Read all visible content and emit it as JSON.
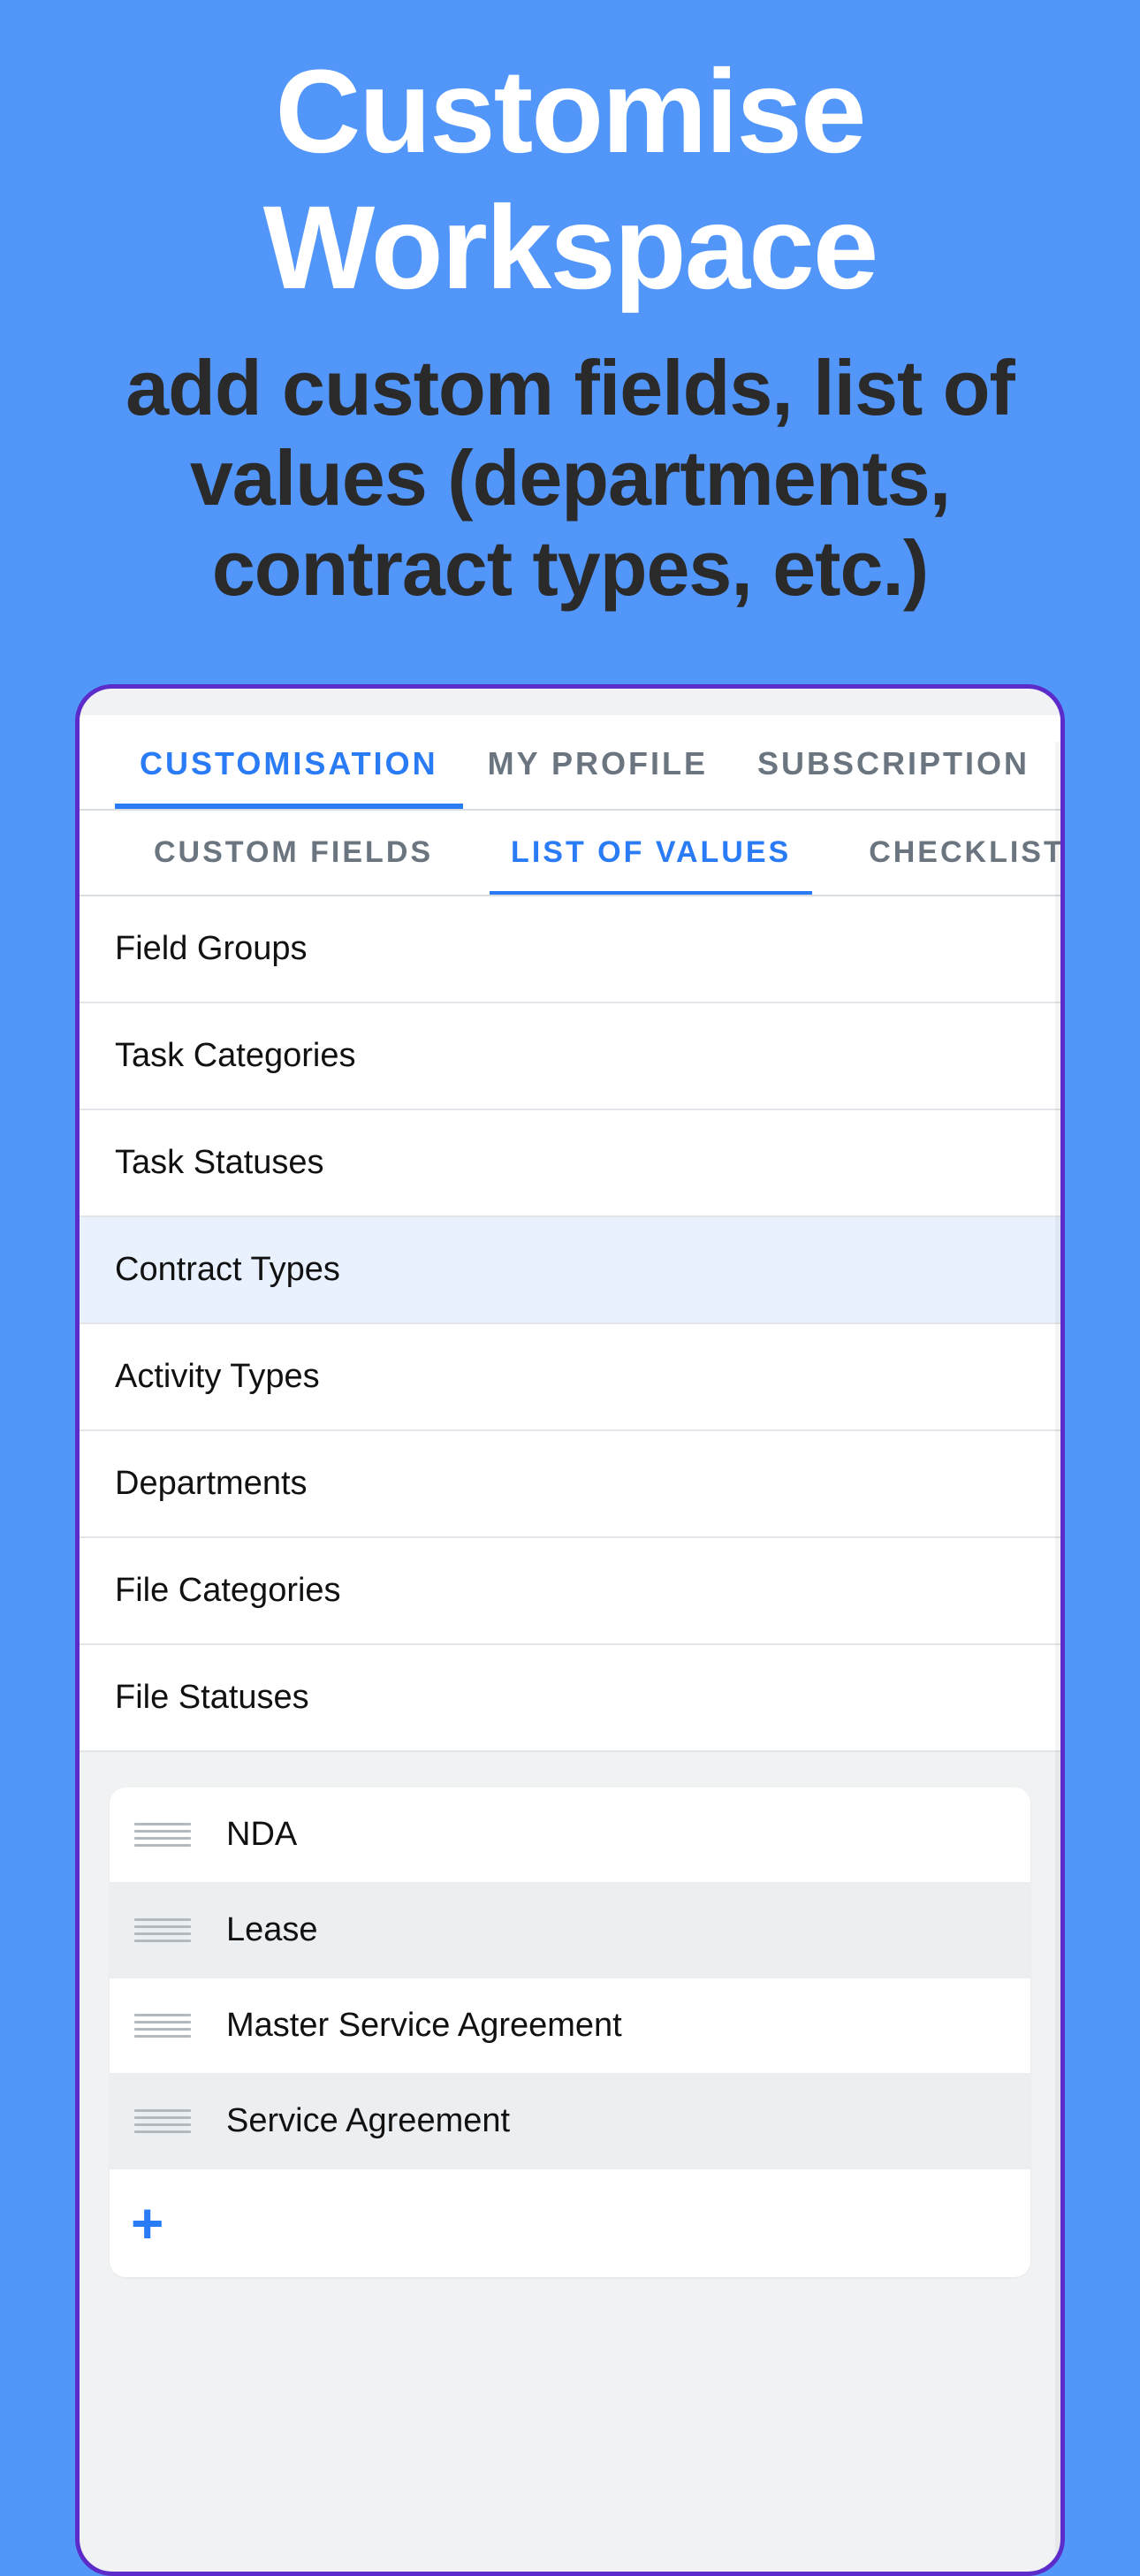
{
  "hero": {
    "title": "Customise Workspace",
    "subtitle": "add custom fields, list of values (departments, contract types, etc.)"
  },
  "tabs_primary": [
    {
      "label": "CUSTOMISATION",
      "active": true
    },
    {
      "label": "MY PROFILE",
      "active": false
    },
    {
      "label": "SUBSCRIPTION",
      "active": false
    }
  ],
  "tabs_secondary": [
    {
      "label": "CUSTOM FIELDS",
      "active": false
    },
    {
      "label": "LIST OF VALUES",
      "active": true
    },
    {
      "label": "CHECKLIST",
      "active": false
    }
  ],
  "categories": [
    {
      "label": "Field Groups",
      "selected": false
    },
    {
      "label": "Task Categories",
      "selected": false
    },
    {
      "label": "Task Statuses",
      "selected": false
    },
    {
      "label": "Contract Types",
      "selected": true
    },
    {
      "label": "Activity Types",
      "selected": false
    },
    {
      "label": "Departments",
      "selected": false
    },
    {
      "label": "File Categories",
      "selected": false
    },
    {
      "label": "File Statuses",
      "selected": false
    }
  ],
  "values": [
    {
      "label": "NDA"
    },
    {
      "label": "Lease"
    },
    {
      "label": "Master Service Agreement"
    },
    {
      "label": "Service Agreement"
    }
  ]
}
